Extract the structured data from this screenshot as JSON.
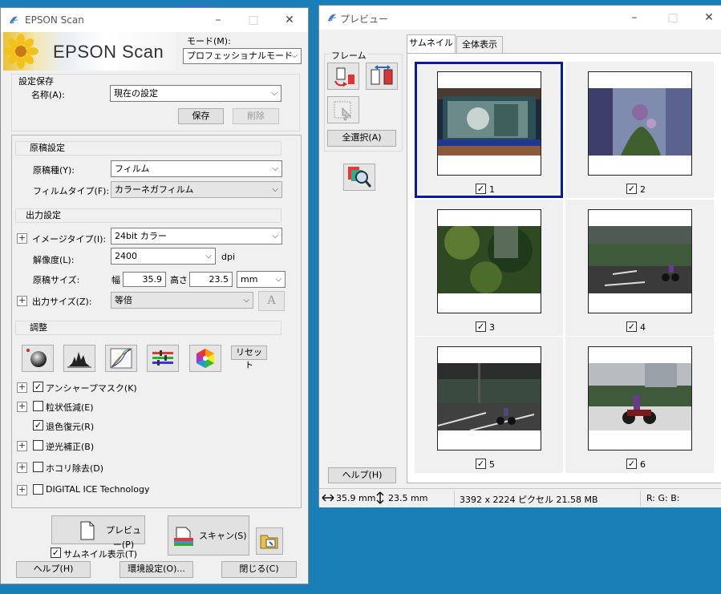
{
  "colors": {
    "desktop": "#1a7fb7",
    "selection_border": "#0a19a0"
  },
  "left_window": {
    "title": "EPSON Scan",
    "logo_text": "EPSON Scan",
    "mode": {
      "label": "モード(M):",
      "value": "プロフェッショナルモード"
    },
    "settings_save": {
      "heading": "設定保存",
      "name_label": "名称(A):",
      "name_value": "現在の設定",
      "save_label": "保存",
      "delete_label": "削除"
    },
    "document": {
      "heading": "原稿設定",
      "type_label": "原稿種(Y):",
      "type_value": "フィルム",
      "film_type_label": "フィルムタイプ(F):",
      "film_type_value": "カラーネガフィルム"
    },
    "output": {
      "heading": "出力設定",
      "image_type_label": "イメージタイプ(I):",
      "image_type_value": "24bit カラー",
      "resolution_label": "解像度(L):",
      "resolution_value": "2400",
      "resolution_unit": "dpi",
      "doc_size_label": "原稿サイズ:",
      "width_label": "幅",
      "width_value": "35.9",
      "height_label": "高さ",
      "height_value": "23.5",
      "size_unit": "mm",
      "output_size_label": "出力サイズ(Z):",
      "output_size_value": "等倍",
      "font_btn": "A"
    },
    "adjust": {
      "heading": "調整",
      "reset_label": "リセット",
      "tool_icons": [
        "auto-exposure-icon",
        "histogram-icon",
        "tone-curve-icon",
        "color-balance-icon",
        "color-palette-icon"
      ],
      "options": [
        {
          "label": "アンシャープマスク(K)",
          "checked": true
        },
        {
          "label": "粒状低減(E)",
          "checked": false
        },
        {
          "label": "退色復元(R)",
          "checked": true
        },
        {
          "label": "逆光補正(B)",
          "checked": false
        },
        {
          "label": "ホコリ除去(D)",
          "checked": false
        },
        {
          "label": "DIGITAL ICE Technology",
          "checked": false
        }
      ]
    },
    "preview_label": "プレビュー(P)",
    "scan_label": "スキャン(S)",
    "thumbnail_label": "サムネイル表示(T)",
    "help_label": "ヘルプ(H)",
    "config_label": "環境設定(O)...",
    "close_label": "閉じる(C)"
  },
  "right_window": {
    "title": "プレビュー",
    "frame_group": "フレーム",
    "select_all_label": "全選択(A)",
    "help_label": "ヘルプ(H)",
    "tabs": [
      {
        "label": "サムネイル",
        "active": true
      },
      {
        "label": "全体表示",
        "active": false
      }
    ],
    "thumbnails": [
      {
        "number": "1",
        "checked": true,
        "selected": true
      },
      {
        "number": "2",
        "checked": true,
        "selected": false
      },
      {
        "number": "3",
        "checked": true,
        "selected": false
      },
      {
        "number": "4",
        "checked": true,
        "selected": false
      },
      {
        "number": "5",
        "checked": true,
        "selected": false
      },
      {
        "number": "6",
        "checked": true,
        "selected": false
      }
    ],
    "status": {
      "width": "35.9 mm",
      "height": "23.5 mm",
      "pixels": "3392 x 2224 ピクセル 21.58 MB",
      "rgb": "R: G: B:"
    }
  }
}
